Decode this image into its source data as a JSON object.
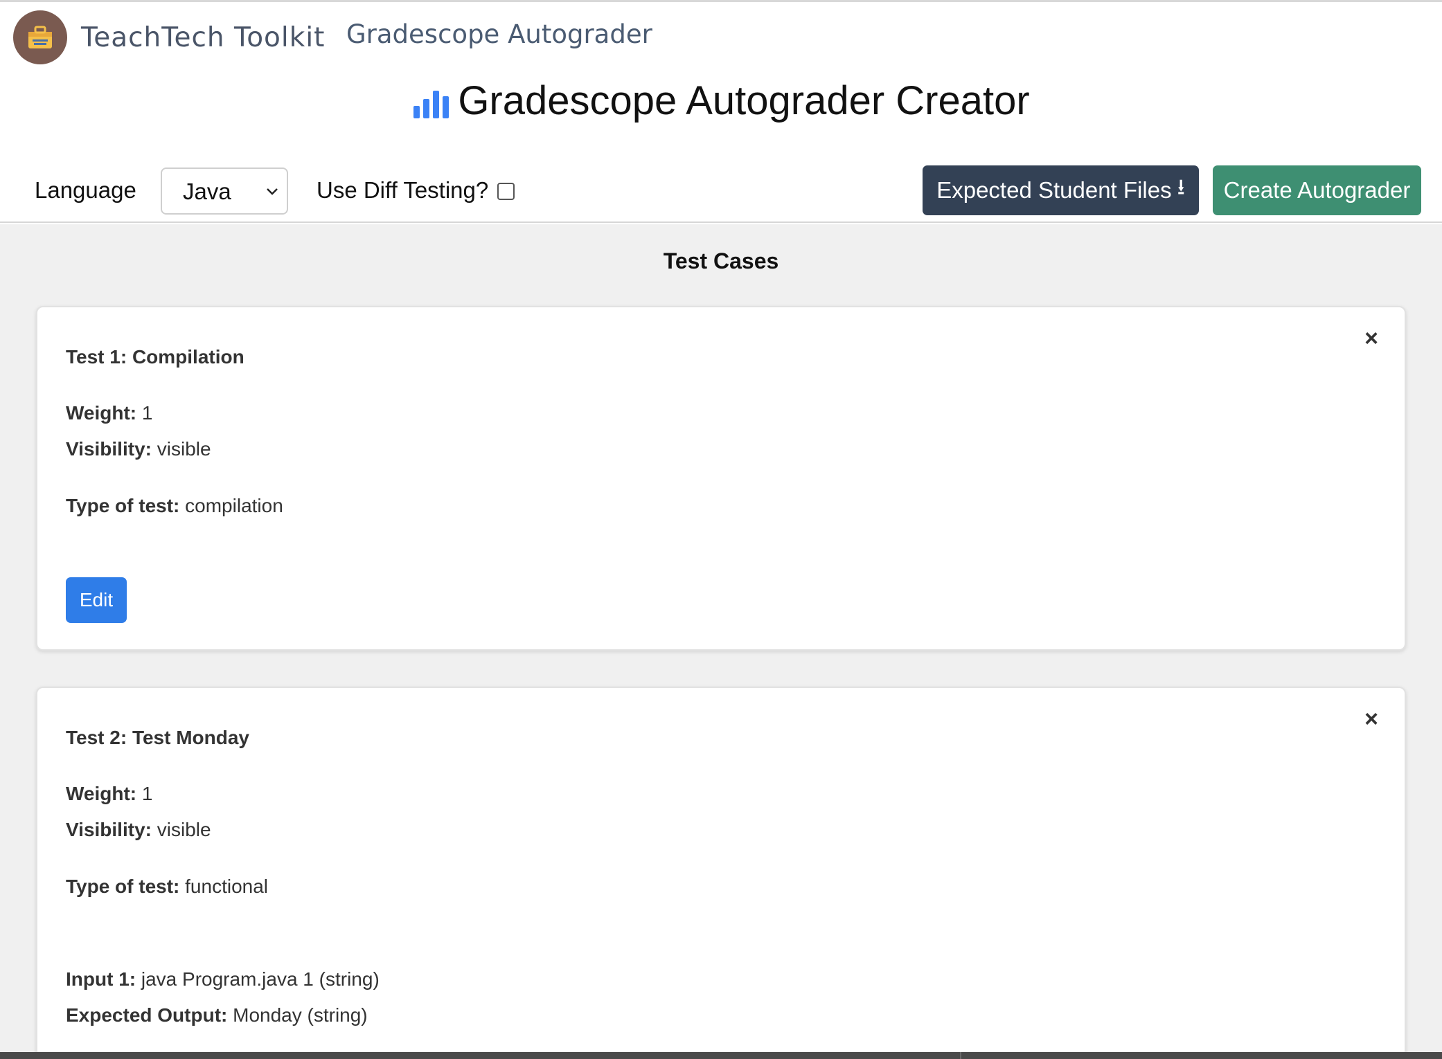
{
  "brand": {
    "name": "TeachTech Toolkit",
    "section": "Gradescope Autograder"
  },
  "page": {
    "title": "Gradescope Autograder Creator",
    "title_icon": "bar-chart-icon",
    "accent_color": "#3b82f6"
  },
  "toolbar": {
    "language_label": "Language",
    "language_value": "Java",
    "diff_label": "Use Diff Testing?",
    "diff_checked": false,
    "expected_files_label": "Expected Student Files",
    "expected_files_icon": "⭳",
    "create_label": "Create Autograder"
  },
  "main": {
    "title": "Test Cases",
    "close_symbol": "×",
    "tests": [
      {
        "title": "Test 1: Compilation",
        "weight_label": "Weight:",
        "weight": "1",
        "visibility_label": "Visibility:",
        "visibility": "visible",
        "type_label": "Type of test:",
        "type": "compilation",
        "edit_label": "Edit"
      },
      {
        "title": "Test 2: Test Monday",
        "weight_label": "Weight:",
        "weight": "1",
        "visibility_label": "Visibility:",
        "visibility": "visible",
        "type_label": "Type of test:",
        "type": "functional",
        "input_label": "Input 1:",
        "input": "java Program.java 1 (string)",
        "output_label": "Expected Output:",
        "output": "Monday (string)"
      }
    ]
  }
}
